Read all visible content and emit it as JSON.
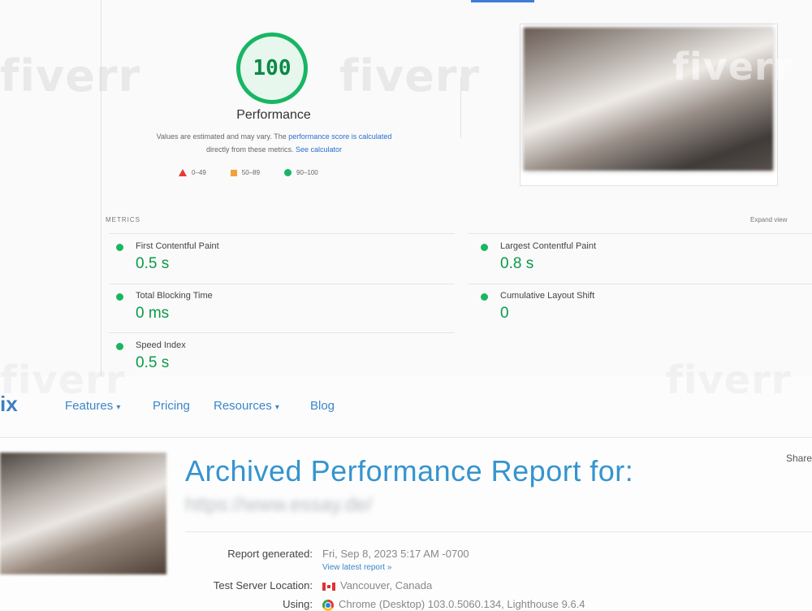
{
  "lighthouse": {
    "score": "100",
    "category": "Performance",
    "note_prefix": "Values are estimated and may vary. The",
    "note_link": "performance score is calculated",
    "note_middle": "directly from these metrics.",
    "note_calc": "See calculator",
    "legend": [
      {
        "label": "0–49",
        "shape": "triangle",
        "color": "#e53935"
      },
      {
        "label": "50–89",
        "shape": "square",
        "color": "#f2a23a"
      },
      {
        "label": "90–100",
        "shape": "circle",
        "color": "#18b663"
      }
    ],
    "metrics_heading": "METRICS",
    "expand_view": "Expand view",
    "metrics": [
      {
        "name": "First Contentful Paint",
        "value": "0.5 s"
      },
      {
        "name": "Largest Contentful Paint",
        "value": "0.8 s"
      },
      {
        "name": "Total Blocking Time",
        "value": "0 ms"
      },
      {
        "name": "Cumulative Layout Shift",
        "value": "0"
      },
      {
        "name": "Speed Index",
        "value": "0.5 s"
      }
    ],
    "pass_color": "#18b663"
  },
  "watermark": "fiverr",
  "nav": {
    "logo": "ix",
    "links": [
      "Features",
      "Pricing",
      "Resources",
      "Blog"
    ]
  },
  "report": {
    "title": "Archived Performance Report for:",
    "url": "https://www.essay.de/",
    "share": "Share",
    "rows": [
      {
        "label": "Report generated:",
        "value": "Fri, Sep 8, 2023 5:17 AM -0700"
      },
      {
        "label": "Test Server Location:",
        "value": "Vancouver, Canada"
      },
      {
        "label": "Using:",
        "value": "Chrome (Desktop) 103.0.5060.134, Lighthouse 9.6.4"
      }
    ],
    "latest_link": "View latest report »"
  }
}
